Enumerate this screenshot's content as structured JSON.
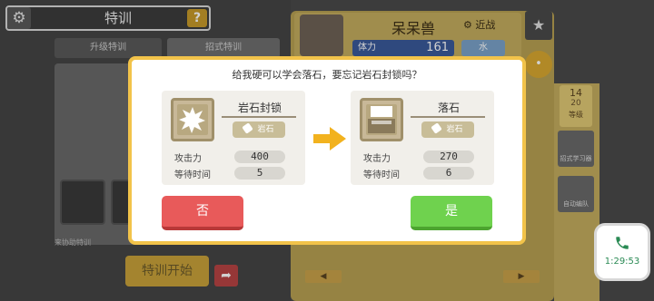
{
  "background": {
    "title": "特训",
    "help_glyph": "?",
    "gear_glyph": "⚙",
    "tab_upgrade": "升级特训",
    "tab_moves": "招式特训",
    "note": "来协助特训",
    "train_button": "特训开始",
    "share_glyph": "➦",
    "pokemon_name": "呆呆兽",
    "role": "近战",
    "hp_label": "体力",
    "hp_value": "161",
    "type_label": "水",
    "star_glyph": "★",
    "chat_glyph": "•",
    "level_top": "14",
    "level_sub": "20",
    "level_label": "等级",
    "side_btn_moves": "招式学习器",
    "side_btn_auto": "自动编队",
    "nav_left": "◀",
    "nav_right": "▶"
  },
  "call_timer": {
    "time": "1:29:53"
  },
  "dialog": {
    "question": "给我硬可以学会落石，要忘记岩石封锁吗？",
    "old_move": {
      "name": "岩石封锁",
      "type": "岩石",
      "attack_label": "攻击力",
      "attack": "400",
      "wait_label": "等待时间",
      "wait": "5"
    },
    "new_move": {
      "name": "落石",
      "type": "岩石",
      "attack_label": "攻击力",
      "attack": "270",
      "wait_label": "等待时间",
      "wait": "6"
    },
    "no_label": "否",
    "yes_label": "是"
  },
  "colors": {
    "dialog_border": "#f2c34a",
    "no_button": "#e85a5a",
    "yes_button": "#6fd24e",
    "arrow": "#f2b21e",
    "call_green": "#2a8a54"
  }
}
